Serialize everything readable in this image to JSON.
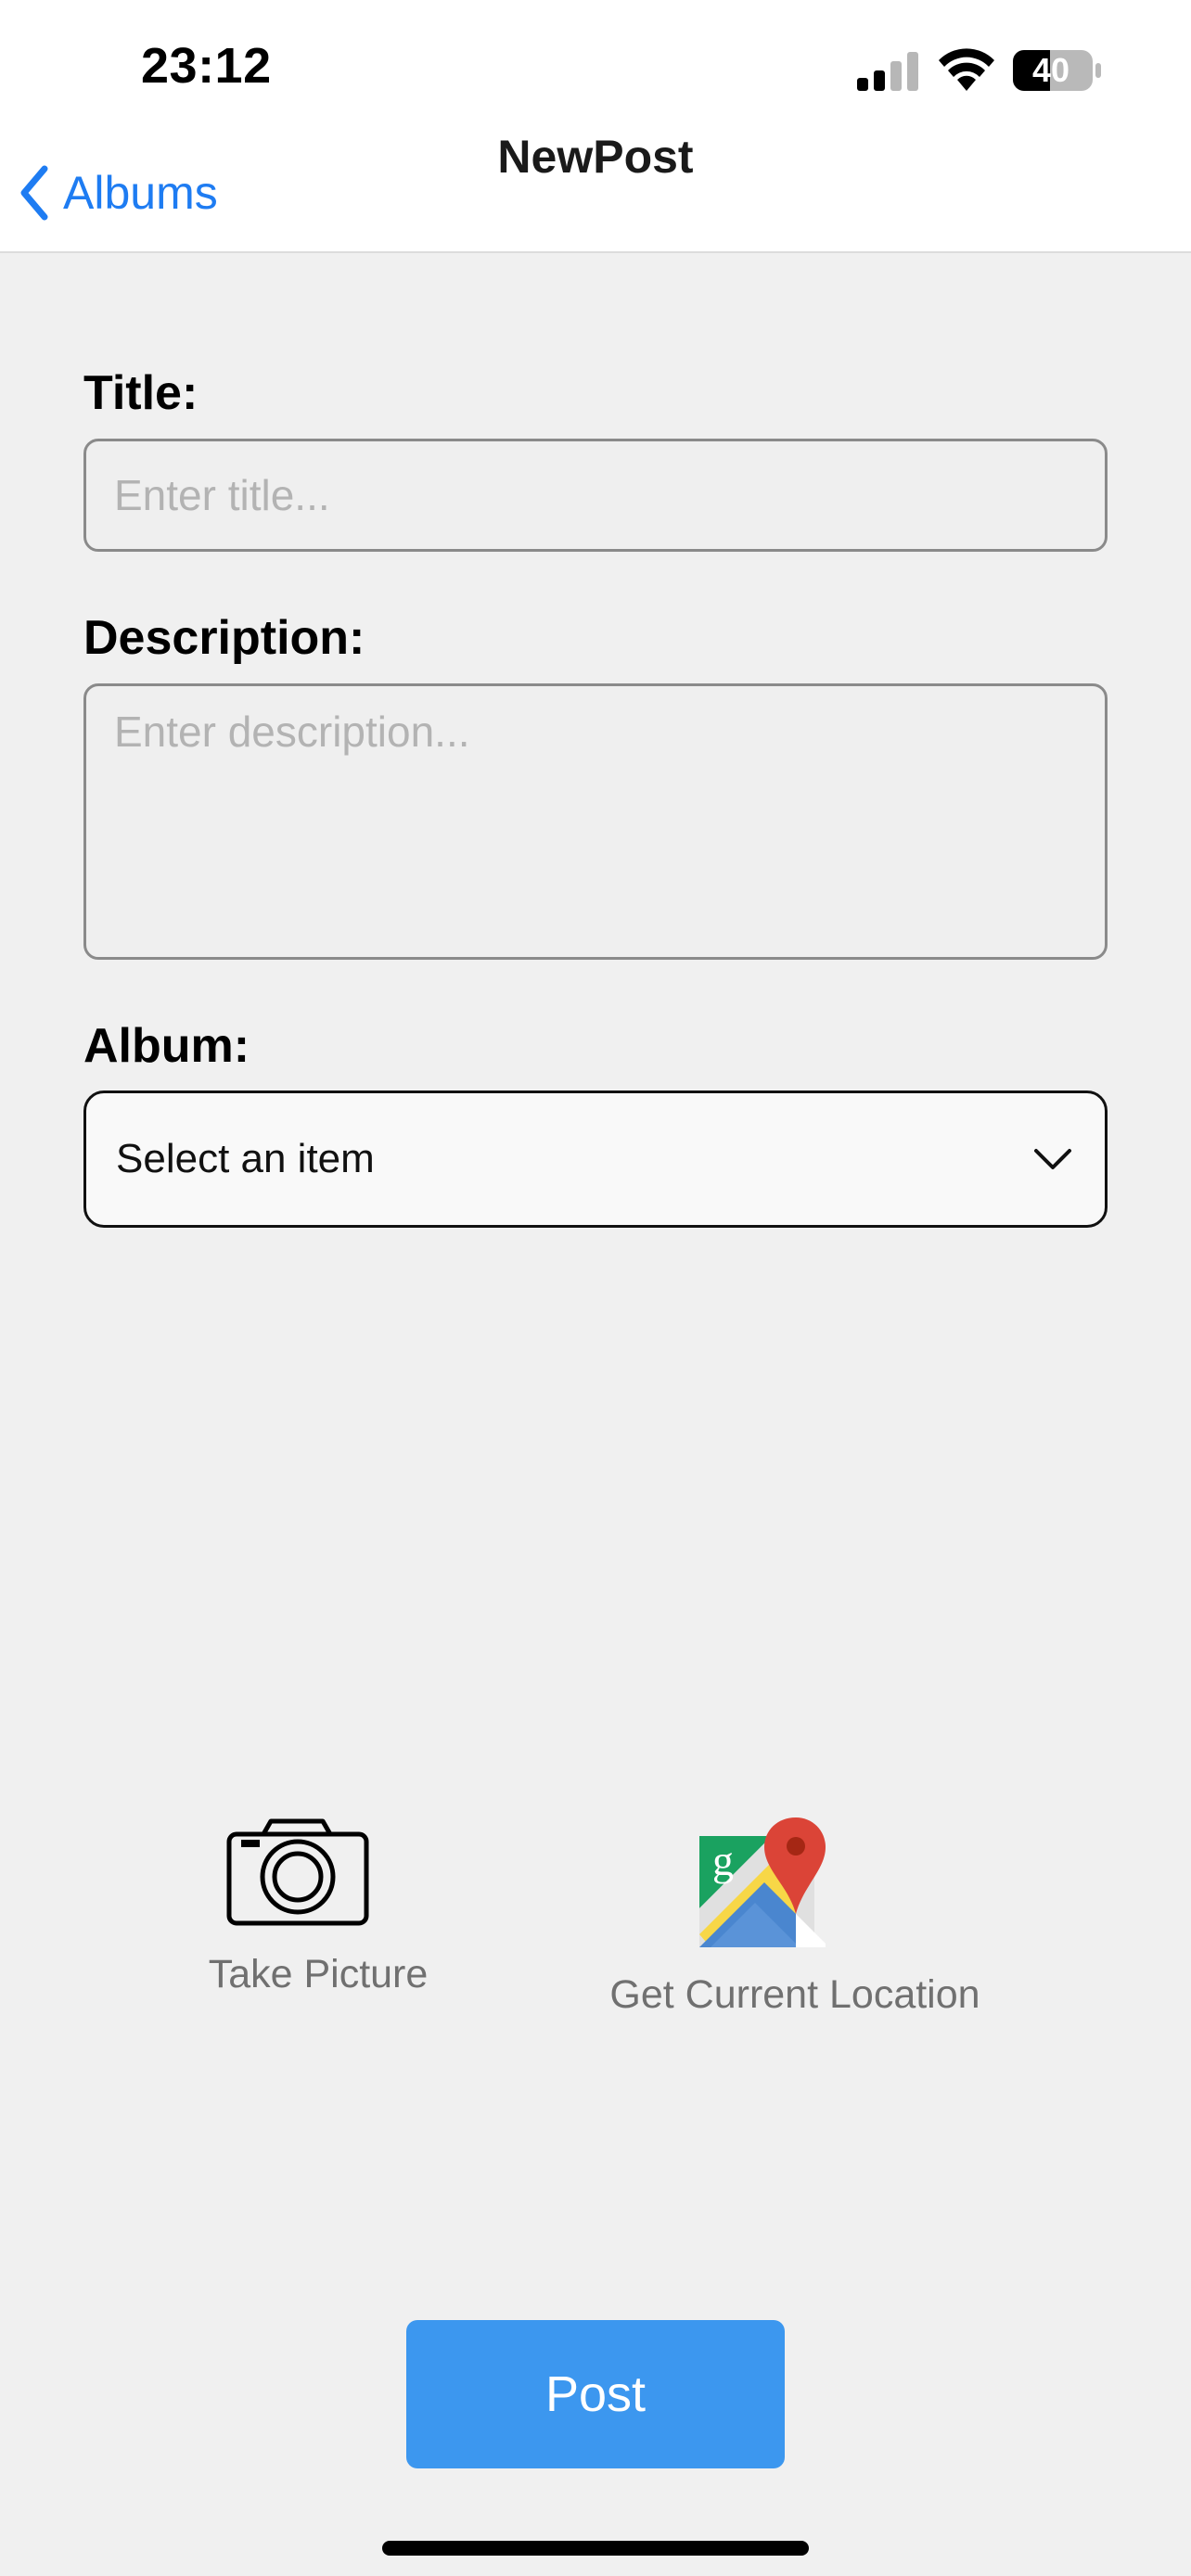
{
  "status_bar": {
    "time": "23:12",
    "battery": "40"
  },
  "nav": {
    "back_label": "Albums",
    "title": "NewPost"
  },
  "form": {
    "title_label": "Title:",
    "title_placeholder": "Enter title...",
    "description_label": "Description:",
    "description_placeholder": "Enter description...",
    "album_label": "Album:",
    "album_selected": "Select an item"
  },
  "actions": {
    "take_picture_label": "Take Picture",
    "get_location_label": "Get Current Location"
  },
  "post_button_label": "Post",
  "colors": {
    "accent": "#1e7cf2",
    "post_button": "#3c97ef",
    "background": "#f0f0f0"
  },
  "icons": [
    "chevron-left-icon",
    "signal-icon",
    "wifi-icon",
    "battery-icon",
    "chevron-down-icon",
    "camera-icon",
    "google-maps-icon"
  ]
}
